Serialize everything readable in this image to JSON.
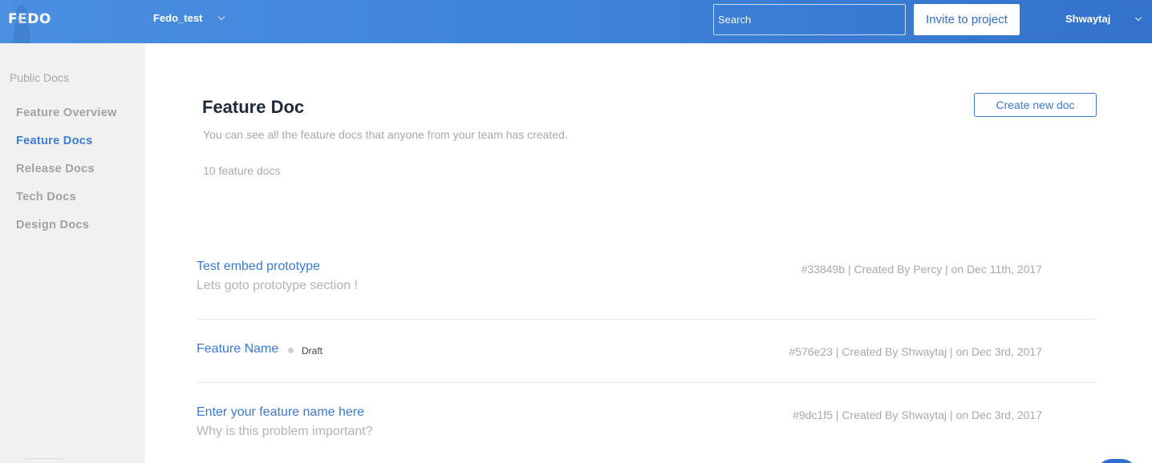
{
  "header": {
    "logo_text": "FEDO",
    "project_name": "Fedo_test",
    "search_placeholder": "Search",
    "invite_label": "Invite to project",
    "user_name": "Shwaytaj"
  },
  "sidebar": {
    "heading": "Public Docs",
    "items": [
      {
        "label": "Feature Overview",
        "active": false
      },
      {
        "label": "Feature Docs",
        "active": true
      },
      {
        "label": "Release Docs",
        "active": false
      },
      {
        "label": "Tech Docs",
        "active": false
      },
      {
        "label": "Design Docs",
        "active": false
      }
    ]
  },
  "main": {
    "title": "Feature Doc",
    "subtitle": "You can see all the feature docs that anyone from your team has created.",
    "count_text": "10 feature docs",
    "create_label": "Create new doc",
    "docs": [
      {
        "title": "Test embed prototype",
        "description": "Lets goto prototype section !",
        "meta": "#33849b | Created By Percy | on Dec 11th, 2017"
      },
      {
        "title": "Feature Name",
        "status": "Draft",
        "meta": "#576e23 | Created By Shwaytaj | on Dec 3rd, 2017"
      },
      {
        "title": "Enter your feature name here",
        "description": "Why is this problem important?",
        "meta": "#9dc1f5 | Created By Shwaytaj | on Dec 3rd, 2017"
      }
    ]
  },
  "colors": {
    "accent": "#3a7ad6",
    "header_gradient_start": "#4a8fe0",
    "header_gradient_end": "#3372cc",
    "sidebar_bg": "#f1f1f1"
  }
}
